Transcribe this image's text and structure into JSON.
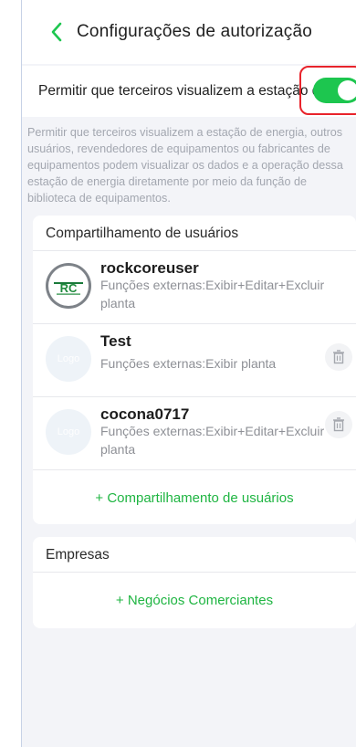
{
  "header": {
    "title": "Configurações de autorização"
  },
  "permission": {
    "label": "Permitir que terceiros visualizem a estação de energia",
    "enabled": true,
    "description": "Permitir que terceiros visualizem a estação de energia, outros usuários, revendedores de equipamentos ou fabricantes de equipamentos podem visualizar os dados e a operação dessa estação de energia diretamente por meio da função de biblioteca de equipamentos."
  },
  "user_sharing": {
    "title": "Compartilhamento de usuários",
    "users": [
      {
        "name": "rockcoreuser",
        "functions": "Funções externas:Exibir+Editar+Excluir planta",
        "avatar": "RC"
      },
      {
        "name": "Test",
        "functions": "Funções externas:Exibir planta",
        "avatar": "Logo"
      },
      {
        "name": "cocona0717",
        "functions": "Funções externas:Exibir+Editar+Excluir planta",
        "avatar": "Logo"
      }
    ],
    "add_label": "+ Compartilhamento de usuários"
  },
  "companies": {
    "title": "Empresas",
    "add_label": "+ Negócios Comerciantes"
  },
  "colors": {
    "accent": "#1dc64f",
    "highlight": "#e8232b"
  }
}
